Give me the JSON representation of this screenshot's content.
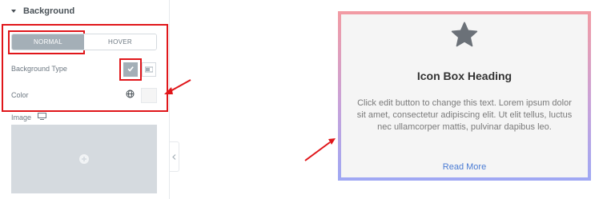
{
  "panel": {
    "section_title": "Background",
    "tabs": [
      {
        "label": "NORMAL",
        "active": true
      },
      {
        "label": "HOVER",
        "active": false
      }
    ],
    "background_type_label": "Background Type",
    "color_label": "Color",
    "image_label": "Image",
    "icons": {
      "caret": "caret-down-icon",
      "classic": "check-icon",
      "gradient": "gradient-icon",
      "global": "globe-icon",
      "responsive": "desktop-icon",
      "add": "plus-icon",
      "collapse": "chevron-left-icon"
    },
    "color_value": "#f5f5f5"
  },
  "preview": {
    "icon": "star-icon",
    "heading": "Icon Box Heading",
    "description": "Click edit button to change this text. Lorem ipsum dolor sit amet, consectetur adipiscing elit. Ut elit tellus, luctus nec ullamcorper mattis, pulvinar dapibus leo.",
    "link_label": "Read More",
    "border_gradient": [
      "#f29ba3",
      "#9fa8f4"
    ]
  },
  "annotations": {
    "highlight_color": "#e0161a"
  }
}
